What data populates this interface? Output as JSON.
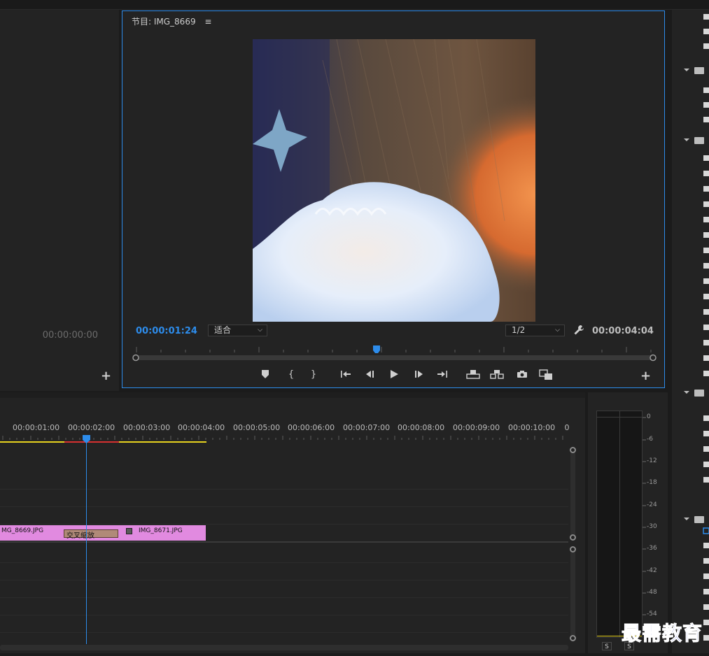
{
  "source_monitor": {
    "timecode": "00:00:00:00",
    "add_label": "+"
  },
  "program_monitor": {
    "title": "节目: IMG_8669",
    "menu_icon": "hamburger-icon",
    "current_timecode": "00:00:01:24",
    "zoom_select": "适合",
    "resolution_select": "1/2",
    "settings_icon": "wrench-icon",
    "duration_timecode": "00:00:04:04",
    "playhead_fraction": 0.47,
    "controls": {
      "marker": "add-marker-icon",
      "mark_in": "{",
      "mark_out": "}",
      "go_in": "go-to-in-icon",
      "step_back": "step-back-icon",
      "play": "play-icon",
      "step_forward": "step-forward-icon",
      "go_out": "go-to-out-icon",
      "lift": "lift-icon",
      "extract": "extract-icon",
      "export_frame": "camera-icon",
      "compare": "compare-icon",
      "add": "+"
    }
  },
  "timeline": {
    "ruler": [
      "00:00:01:00",
      "00:00:02:00",
      "00:00:03:00",
      "00:00:04:00",
      "00:00:05:00",
      "00:00:06:00",
      "00:00:07:00",
      "00:00:08:00",
      "00:00:09:00",
      "00:00:10:00",
      "0"
    ],
    "playhead_time": "00:00:01:24",
    "clips": [
      {
        "label": "MG_8669.JPG",
        "color": "#e18ae0"
      },
      {
        "label": "交叉缩放",
        "color": "#b08a78"
      },
      {
        "label": "IMG_8671.JPG",
        "color": "#e18ae0"
      }
    ]
  },
  "audio_meter": {
    "scale": [
      "0",
      "-6",
      "-12",
      "-18",
      "-24",
      "-30",
      "-36",
      "-42",
      "-48",
      "-54"
    ],
    "solo_left": "S",
    "solo_right": "S"
  },
  "watermark": "最需教育",
  "colors": {
    "accent": "#2d8ceb",
    "clip": "#e18ae0",
    "transition": "#b08a78",
    "render_yellow": "#e6d21e",
    "render_red": "#d63030"
  }
}
